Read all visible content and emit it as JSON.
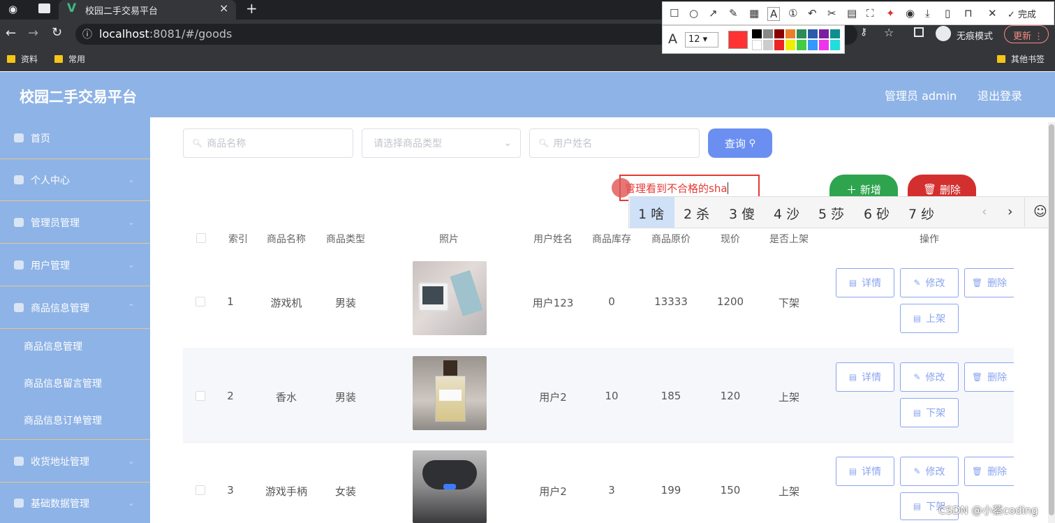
{
  "browser": {
    "tab_title": "校园二手交易平台",
    "url_host": "localhost",
    "url_rest": ":8081/#/goods",
    "incognito": "无痕模式",
    "update": "更新",
    "bookmarks": [
      "资料",
      "常用"
    ],
    "other_bookmarks": "其他书签"
  },
  "tool": {
    "done": "完成",
    "font_size": "12",
    "font_label": "A"
  },
  "header": {
    "title": "校园二手交易平台",
    "admin": "管理员 admin",
    "logout": "退出登录"
  },
  "sidebar": {
    "items": [
      "首页",
      "个人中心",
      "管理员管理",
      "用户管理",
      "商品信息管理"
    ],
    "sub_items": [
      "商品信息管理",
      "商品信息留言管理",
      "商品信息订单管理"
    ],
    "items2": [
      "收货地址管理",
      "基础数据管理"
    ]
  },
  "search": {
    "name_placeholder": "商品名称",
    "type_placeholder": "请选择商品类型",
    "user_placeholder": "用户姓名",
    "query": "查询"
  },
  "actions": {
    "add": "新增",
    "delete": "删除"
  },
  "annotation": "管理看到不合格的sha",
  "ime": {
    "candidates": [
      "1 啥",
      "2 杀",
      "3 傻",
      "4 沙",
      "5 莎",
      "6 砂",
      "7 纱"
    ]
  },
  "table": {
    "headers": [
      "索引",
      "商品名称",
      "商品类型",
      "照片",
      "用户姓名",
      "商品库存",
      "商品原价",
      "现价",
      "是否上架",
      "操作"
    ],
    "rows": [
      {
        "index": "1",
        "name": "游戏机",
        "type": "男装",
        "user": "用户123",
        "stock": "0",
        "orig": "13333",
        "price": "1200",
        "status": "下架",
        "toggle": "上架"
      },
      {
        "index": "2",
        "name": "香水",
        "type": "男装",
        "user": "用户2",
        "stock": "10",
        "orig": "185",
        "price": "120",
        "status": "上架",
        "toggle": "下架"
      },
      {
        "index": "3",
        "name": "游戏手柄",
        "type": "女装",
        "user": "用户2",
        "stock": "3",
        "orig": "199",
        "price": "150",
        "status": "上架",
        "toggle": "下架"
      }
    ],
    "detail": "详情",
    "edit": "修改",
    "remove": "删除"
  },
  "watermark": "CSDN @小蔡coding",
  "colors": {
    "sidebar": "#8eb3e6",
    "primary": "#6a8ff0",
    "add": "#2ea44f",
    "danger": "#d32f2f"
  }
}
